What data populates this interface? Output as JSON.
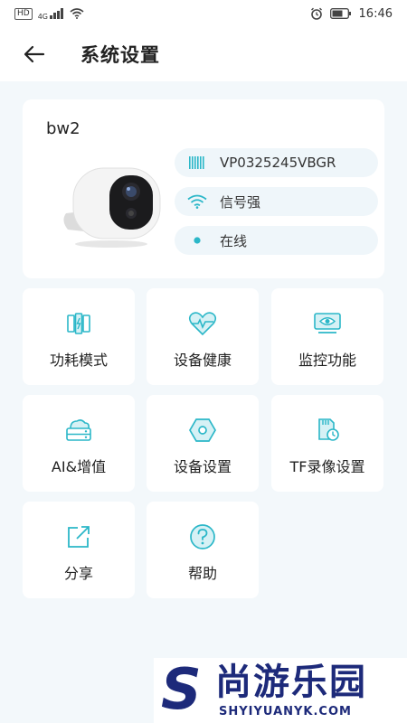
{
  "status_bar": {
    "network_badge": "HD",
    "network_type": "4G",
    "time": "16:46"
  },
  "header": {
    "title": "系统设置"
  },
  "device": {
    "name": "bw2",
    "serial": "VP0325245VBGR",
    "signal": "信号强",
    "status": "在线"
  },
  "tiles": [
    {
      "label": "功耗模式",
      "icon": "battery-mode-icon"
    },
    {
      "label": "设备健康",
      "icon": "heart-pulse-icon"
    },
    {
      "label": "监控功能",
      "icon": "monitor-eye-icon"
    },
    {
      "label": "AI&增值",
      "icon": "cloud-storage-icon"
    },
    {
      "label": "设备设置",
      "icon": "hex-settings-icon"
    },
    {
      "label": "TF录像设置",
      "icon": "sd-card-icon"
    },
    {
      "label": "分享",
      "icon": "share-icon"
    },
    {
      "label": "帮助",
      "icon": "help-icon"
    }
  ],
  "watermark": {
    "logo_letter": "S",
    "text_cn": "尚游乐园",
    "text_en": "SHYIYUANYK.COM"
  },
  "colors": {
    "accent": "#2bb7c8",
    "background": "#f3f8fb",
    "pill_bg": "#eff6fa"
  }
}
